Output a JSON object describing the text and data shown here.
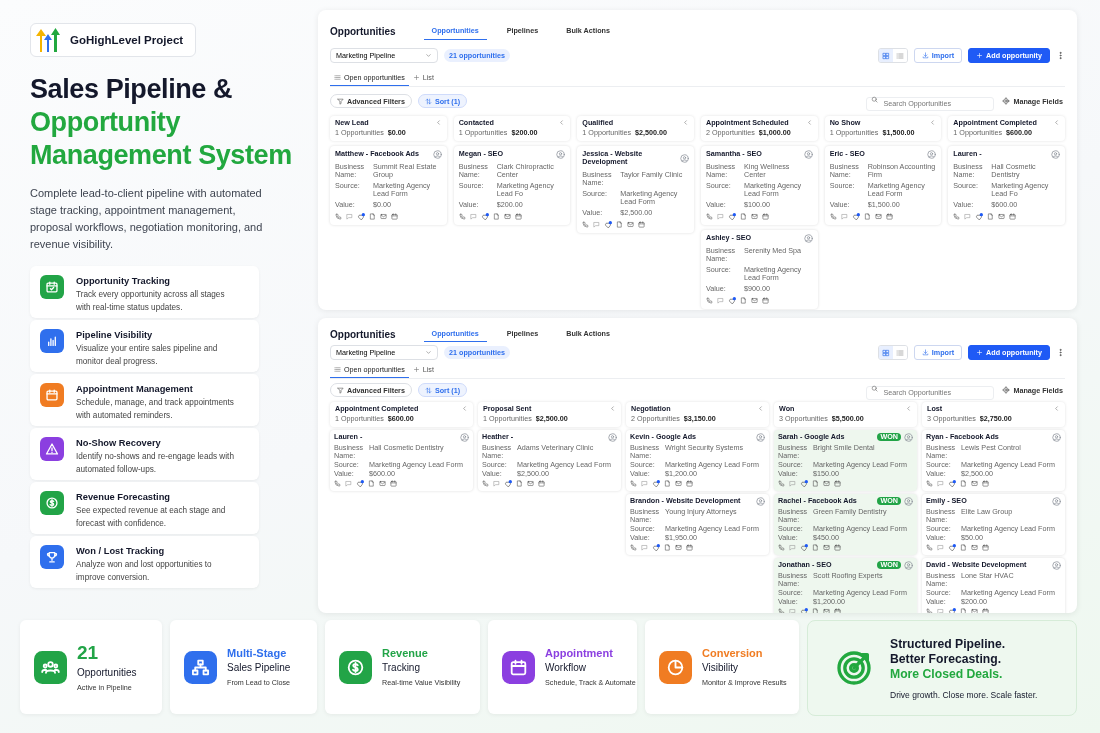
{
  "brand": {
    "name": "GoHighLevel Project"
  },
  "headline": {
    "title": "Sales Pipeline &",
    "highlight": "Opportunity Management System"
  },
  "description": "Complete lead-to-client pipeline with automated stage tracking, appointment management, proposal workflows, negotiation monitoring, and revenue visibility.",
  "features": [
    {
      "kind": "calendar-check",
      "color": "#22a447",
      "title": "Opportunity Tracking",
      "text": "Track every opportunity across all stages with real-time status updates."
    },
    {
      "kind": "bar-chart",
      "color": "#2f6fed",
      "title": "Pipeline Visibility",
      "text": "Visualize your entire sales pipeline and monitor deal progress."
    },
    {
      "kind": "calendar",
      "color": "#f07c22",
      "title": "Appointment Management",
      "text": "Schedule, manage, and track appointments with automated reminders."
    },
    {
      "kind": "warning",
      "color": "#8b3fe0",
      "title": "No-Show Recovery",
      "text": "Identify no-shows and re-engage leads with automated follow-ups."
    },
    {
      "kind": "dollar",
      "color": "#22a447",
      "title": "Revenue Forecasting",
      "text": "See expected revenue at each stage and forecast with confidence."
    },
    {
      "kind": "trophy",
      "color": "#2f6fed",
      "title": "Won / Lost Tracking",
      "text": "Analyze won and lost opportunities to improve conversion."
    }
  ],
  "screens": [
    {
      "title": "Opportunities",
      "tabs": [
        {
          "label": "Opportunities",
          "selected": true
        },
        {
          "label": "Pipelines",
          "selected": false
        },
        {
          "label": "Bulk Actions",
          "selected": false
        }
      ],
      "pipeline": "Marketing Pipeline",
      "count": "21 opportunities",
      "views": [
        {
          "kind": "grid",
          "selected": true
        },
        {
          "kind": "list",
          "selected": false
        }
      ],
      "import": "Import",
      "add": "Add opportunity",
      "list_tabs": [
        {
          "kind": "table",
          "label": "Open opportunities",
          "selected": true
        },
        {
          "kind": "plus",
          "label": "List",
          "selected": false
        }
      ],
      "filters": "Advanced Filters",
      "sort": "Sort (1)",
      "search_placeholder": "Search Opportunities",
      "manage": "Manage Fields",
      "stages": [
        {
          "name": "New Lead",
          "count": "1 Opportunities",
          "amount": "$0.00",
          "cards": [
            {
              "title": "Matthew - Facebook Ads",
              "won": false,
              "fields": [
                {
                  "label": "Business Name:",
                  "value": "Summit Real Estate Group"
                },
                {
                  "label": "Source:",
                  "value": "Marketing Agency Lead Form"
                },
                {
                  "label": "Value:",
                  "value": "$0.00"
                }
              ]
            }
          ]
        },
        {
          "name": "Contacted",
          "count": "1 Opportunities",
          "amount": "$200.00",
          "cards": [
            {
              "title": "Megan - SEO",
              "won": false,
              "fields": [
                {
                  "label": "Business Name:",
                  "value": "Clark Chiropractic Center"
                },
                {
                  "label": "Source:",
                  "value": "Marketing Agency Lead Fo"
                },
                {
                  "label": "Value:",
                  "value": "$200.00"
                }
              ]
            }
          ]
        },
        {
          "name": "Qualified",
          "count": "1 Opportunities",
          "amount": "$2,500.00",
          "cards": [
            {
              "title": "Jessica - Website Development",
              "won": false,
              "fields": [
                {
                  "label": "Business Name:",
                  "value": "Taylor Family Clinic"
                },
                {
                  "label": "Source:",
                  "value": "Marketing Agency Lead Form"
                },
                {
                  "label": "Value:",
                  "value": "$2,500.00"
                }
              ]
            }
          ]
        },
        {
          "name": "Appointment Scheduled",
          "count": "2 Opportunities",
          "amount": "$1,000.00",
          "cards": [
            {
              "title": "Samantha - SEO",
              "won": false,
              "fields": [
                {
                  "label": "Business Name:",
                  "value": "King Wellness Center"
                },
                {
                  "label": "Source:",
                  "value": "Marketing Agency Lead Form"
                },
                {
                  "label": "Value:",
                  "value": "$100.00"
                }
              ]
            },
            {
              "title": "Ashley - SEO",
              "won": false,
              "fields": [
                {
                  "label": "Business Name:",
                  "value": "Serenity Med Spa"
                },
                {
                  "label": "Source:",
                  "value": "Marketing Agency Lead Form"
                },
                {
                  "label": "Value:",
                  "value": "$900.00"
                }
              ]
            }
          ]
        },
        {
          "name": "No Show",
          "count": "1 Opportunities",
          "amount": "$1,500.00",
          "cards": [
            {
              "title": "Eric - SEO",
              "won": false,
              "fields": [
                {
                  "label": "Business Name:",
                  "value": "Robinson Accounting Firm"
                },
                {
                  "label": "Source:",
                  "value": "Marketing Agency Lead Form"
                },
                {
                  "label": "Value:",
                  "value": "$1,500.00"
                }
              ]
            }
          ]
        },
        {
          "name": "Appointment Completed",
          "count": "1 Opportunities",
          "amount": "$600.00",
          "cards": [
            {
              "title": "Lauren -",
              "won": false,
              "fields": [
                {
                  "label": "Business Name:",
                  "value": "Hall Cosmetic Dentistry"
                },
                {
                  "label": "Source:",
                  "value": "Marketing Agency Lead Fo"
                },
                {
                  "label": "Value:",
                  "value": "$600.00"
                }
              ]
            }
          ]
        }
      ]
    },
    {
      "title": "Opportunities",
      "tabs": [
        {
          "label": "Opportunities",
          "selected": true
        },
        {
          "label": "Pipelines",
          "selected": false
        },
        {
          "label": "Bulk Actions",
          "selected": false
        }
      ],
      "pipeline": "Marketing Pipeline",
      "count": "21 opportunities",
      "views": [
        {
          "kind": "grid",
          "selected": true
        },
        {
          "kind": "list",
          "selected": false
        }
      ],
      "import": "Import",
      "add": "Add opportunity",
      "list_tabs": [
        {
          "kind": "table",
          "label": "Open opportunities",
          "selected": true
        },
        {
          "kind": "plus",
          "label": "List",
          "selected": false
        }
      ],
      "filters": "Advanced Filters",
      "sort": "Sort (1)",
      "search_placeholder": "Search Opportunities",
      "manage": "Manage Fields",
      "stages": [
        {
          "name": "Appointment Completed",
          "count": "1 Opportunities",
          "amount": "$600.00",
          "cards": [
            {
              "title": "Lauren -",
              "won": false,
              "fields": [
                {
                  "label": "Business Name:",
                  "value": "Hall Cosmetic Dentistry"
                },
                {
                  "label": "Source:",
                  "value": "Marketing Agency Lead Form"
                },
                {
                  "label": "Value:",
                  "value": "$600.00"
                }
              ]
            }
          ]
        },
        {
          "name": "Proposal Sent",
          "count": "1 Opportunities",
          "amount": "$2,500.00",
          "cards": [
            {
              "title": "Heather -",
              "won": false,
              "fields": [
                {
                  "label": "Business Name:",
                  "value": "Adams Veterinary Clinic"
                },
                {
                  "label": "Source:",
                  "value": "Marketing Agency Lead Form"
                },
                {
                  "label": "Value:",
                  "value": "$2,500.00"
                }
              ]
            }
          ]
        },
        {
          "name": "Negotiation",
          "count": "2 Opportunities",
          "amount": "$3,150.00",
          "cards": [
            {
              "title": "Kevin - Google Ads",
              "won": false,
              "fields": [
                {
                  "label": "Business Name:",
                  "value": "Wright Security Systems"
                },
                {
                  "label": "Source:",
                  "value": "Marketing Agency Lead Form"
                },
                {
                  "label": "Value:",
                  "value": "$1,200.00"
                }
              ]
            },
            {
              "title": "Brandon - Website Development",
              "won": false,
              "fields": [
                {
                  "label": "Business Name:",
                  "value": "Young Injury Attorneys"
                },
                {
                  "label": "Source:",
                  "value": "Marketing Agency Lead Form"
                },
                {
                  "label": "Value:",
                  "value": "$1,950.00"
                }
              ]
            }
          ]
        },
        {
          "name": "Won",
          "count": "3 Opportunities",
          "amount": "$5,500.00",
          "cards": [
            {
              "title": "Sarah - Google Ads",
              "won": true,
              "tag": "WON",
              "fields": [
                {
                  "label": "Business Name:",
                  "value": "Bright Smile Dental"
                },
                {
                  "label": "Source:",
                  "value": "Marketing Agency Lead Form"
                },
                {
                  "label": "Value:",
                  "value": "$150.00"
                }
              ]
            },
            {
              "title": "Rachel - Facebook Ads",
              "won": true,
              "tag": "WON",
              "fields": [
                {
                  "label": "Business Name:",
                  "value": "Green Family Dentistry"
                },
                {
                  "label": "Source:",
                  "value": "Marketing Agency Lead Form"
                },
                {
                  "label": "Value:",
                  "value": "$450.00"
                }
              ]
            },
            {
              "title": "Jonathan - SEO",
              "won": true,
              "tag": "WON",
              "fields": [
                {
                  "label": "Business Name:",
                  "value": "Scott Roofing Experts"
                },
                {
                  "label": "Source:",
                  "value": "Marketing Agency Lead Form"
                },
                {
                  "label": "Value:",
                  "value": "$1,200.00"
                }
              ]
            }
          ]
        },
        {
          "name": "Lost",
          "count": "3 Opportunities",
          "amount": "$2,750.00",
          "cards": [
            {
              "title": "Ryan - Facebook Ads",
              "won": false,
              "fields": [
                {
                  "label": "Business Name:",
                  "value": "Lewis Pest Control"
                },
                {
                  "label": "Source:",
                  "value": "Marketing Agency Lead Form"
                },
                {
                  "label": "Value:",
                  "value": "$2,500.00"
                }
              ]
            },
            {
              "title": "Emily - SEO",
              "won": false,
              "fields": [
                {
                  "label": "Business Name:",
                  "value": "Elite Law Group"
                },
                {
                  "label": "Source:",
                  "value": "Marketing Agency Lead Form"
                },
                {
                  "label": "Value:",
                  "value": "$50.00"
                }
              ]
            },
            {
              "title": "David - Website Development",
              "won": false,
              "fields": [
                {
                  "label": "Business Name:",
                  "value": "Lone Star HVAC"
                },
                {
                  "label": "Source:",
                  "value": "Marketing Agency Lead Form"
                },
                {
                  "label": "Value:",
                  "value": "$200.00"
                }
              ]
            }
          ]
        }
      ]
    }
  ],
  "stats": [
    {
      "kind": "people",
      "color": "#22a447",
      "title": "21",
      "line": "Opportunities",
      "sub": "Active in Pipeline"
    },
    {
      "kind": "hierarchy",
      "color": "#2f6fed",
      "title": "Multi-Stage",
      "line": "Sales Pipeline",
      "sub": "From Lead to Close"
    },
    {
      "kind": "dollar",
      "color": "#22a447",
      "title": "Revenue",
      "line": "Tracking",
      "sub": "Real-time Value Visibility"
    },
    {
      "kind": "calendar",
      "color": "#8b3fe0",
      "title": "Appointment",
      "line": "Workflow",
      "sub": "Schedule, Track & Automate"
    },
    {
      "kind": "pie",
      "color": "#f07c22",
      "title": "Conversion",
      "line": "Visibility",
      "sub": "Monitor & Improve Results"
    }
  ],
  "cta": {
    "lines": [
      "Structured Pipeline.",
      "Better Forecasting."
    ],
    "highlight": "More Closed Deals.",
    "tagline": "Drive growth. Close more. Scale faster."
  }
}
